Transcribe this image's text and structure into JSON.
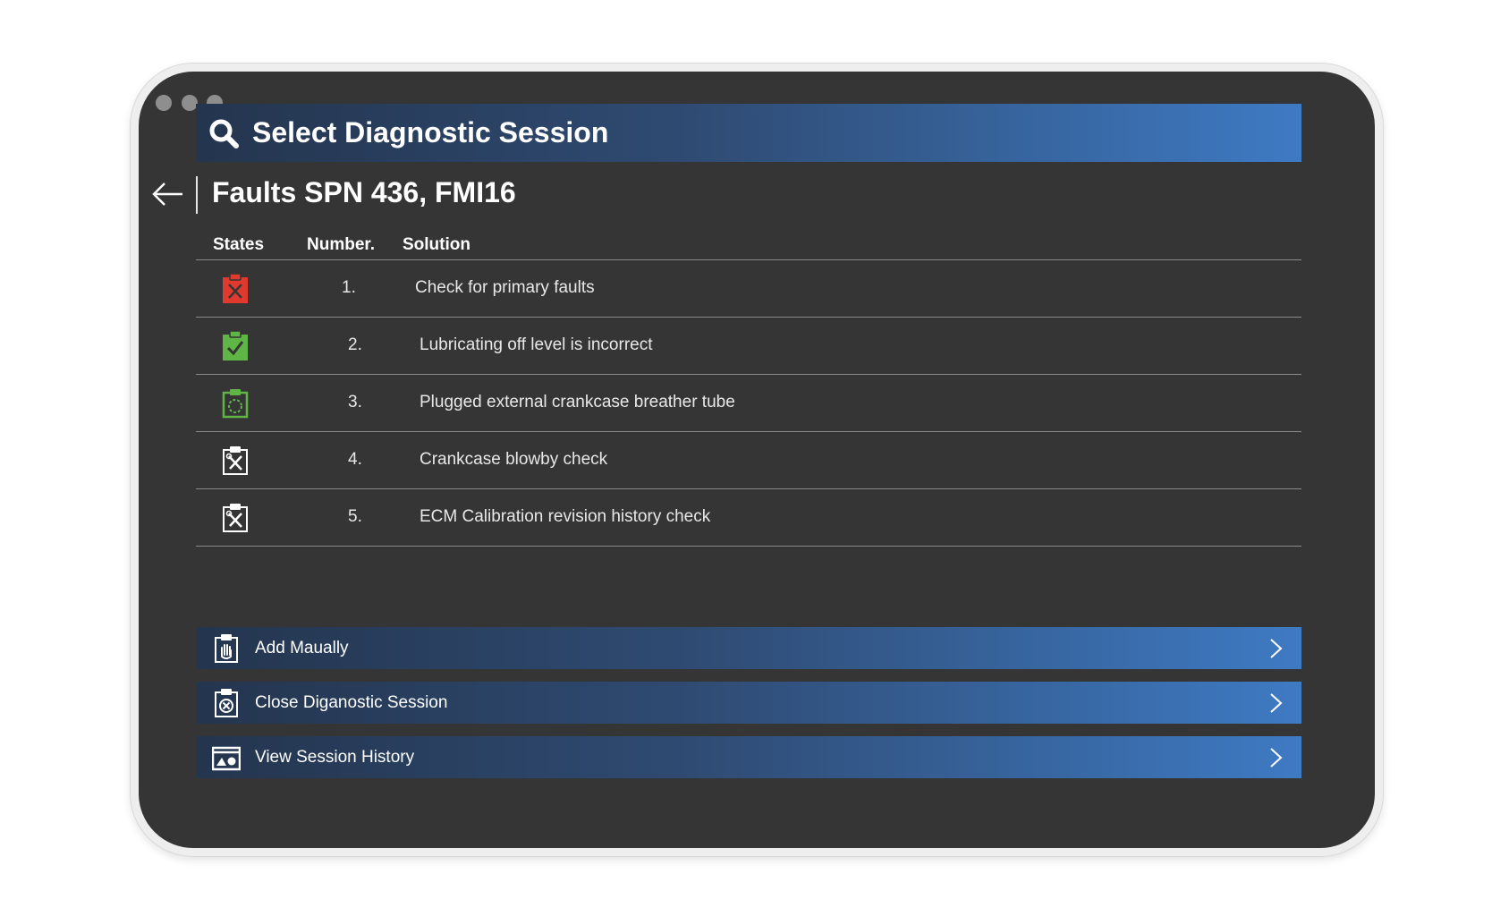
{
  "header": {
    "title": "Select Diagnostic Session",
    "icon": "search-icon"
  },
  "page": {
    "title": "Faults SPN 436, FMI16"
  },
  "table": {
    "columns": [
      "States",
      "Number.",
      "Solution"
    ],
    "rows": [
      {
        "state": "failed",
        "icon": "clipboard-x-icon",
        "color": "#e03a2f",
        "number": "1.",
        "solution": "Check for primary faults"
      },
      {
        "state": "passed",
        "icon": "clipboard-check-icon",
        "color": "#5fb546",
        "number": "2.",
        "solution": "Lubricating off level is incorrect"
      },
      {
        "state": "in-progress",
        "icon": "clipboard-pending-icon",
        "color": "#5fb546",
        "number": "3.",
        "solution": "Plugged external crankcase breather tube"
      },
      {
        "state": "pending",
        "icon": "clipboard-tools-icon",
        "color": "#ffffff",
        "number": "4.",
        "solution": "Crankcase blowby check"
      },
      {
        "state": "pending",
        "icon": "clipboard-tools-icon",
        "color": "#ffffff",
        "number": "5.",
        "solution": "ECM Calibration revision history check"
      }
    ]
  },
  "actions": [
    {
      "label": "Add Maually",
      "icon": "clipboard-hand-icon"
    },
    {
      "label": "Close Diganostic Session",
      "icon": "clipboard-close-icon"
    },
    {
      "label": "View Session History",
      "icon": "history-folder-icon"
    }
  ],
  "colors": {
    "accent_start": "#24354e",
    "accent_end": "#3e7ac3",
    "background": "#353535",
    "fail": "#e03a2f",
    "pass": "#5fb546"
  }
}
